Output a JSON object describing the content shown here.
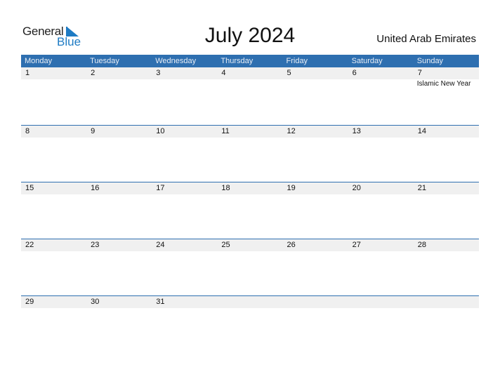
{
  "logo": {
    "general": "General",
    "blue": "Blue"
  },
  "title": "July 2024",
  "country": "United Arab Emirates",
  "weekdays": [
    "Monday",
    "Tuesday",
    "Wednesday",
    "Thursday",
    "Friday",
    "Saturday",
    "Sunday"
  ],
  "weeks": [
    {
      "days": [
        "1",
        "2",
        "3",
        "4",
        "5",
        "6",
        "7"
      ],
      "events": [
        "",
        "",
        "",
        "",
        "",
        "",
        "Islamic New Year"
      ]
    },
    {
      "days": [
        "8",
        "9",
        "10",
        "11",
        "12",
        "13",
        "14"
      ],
      "events": [
        "",
        "",
        "",
        "",
        "",
        "",
        ""
      ]
    },
    {
      "days": [
        "15",
        "16",
        "17",
        "18",
        "19",
        "20",
        "21"
      ],
      "events": [
        "",
        "",
        "",
        "",
        "",
        "",
        ""
      ]
    },
    {
      "days": [
        "22",
        "23",
        "24",
        "25",
        "26",
        "27",
        "28"
      ],
      "events": [
        "",
        "",
        "",
        "",
        "",
        "",
        ""
      ]
    },
    {
      "days": [
        "29",
        "30",
        "31",
        "",
        "",
        "",
        ""
      ],
      "events": [
        "",
        "",
        "",
        "",
        "",
        "",
        ""
      ]
    }
  ]
}
